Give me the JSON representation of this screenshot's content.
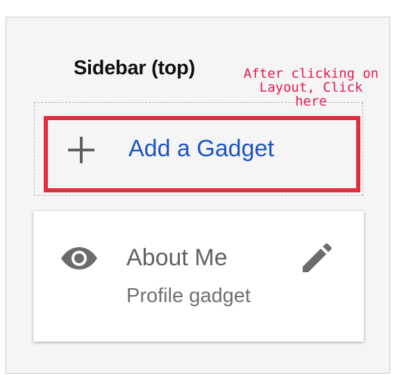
{
  "sidebar": {
    "title": "Sidebar (top)"
  },
  "annotation": {
    "line1": "After clicking on",
    "line2": "Layout, Click",
    "line3": "here",
    "color": "#e8174f"
  },
  "add_gadget": {
    "label": "Add a Gadget",
    "icon": "plus-icon",
    "highlight_color": "#e02e40",
    "link_color": "#1a55c4"
  },
  "gadget_card": {
    "title": "About Me",
    "subtitle": "Profile gadget",
    "visibility_icon": "eye-icon",
    "edit_icon": "pencil-icon"
  }
}
